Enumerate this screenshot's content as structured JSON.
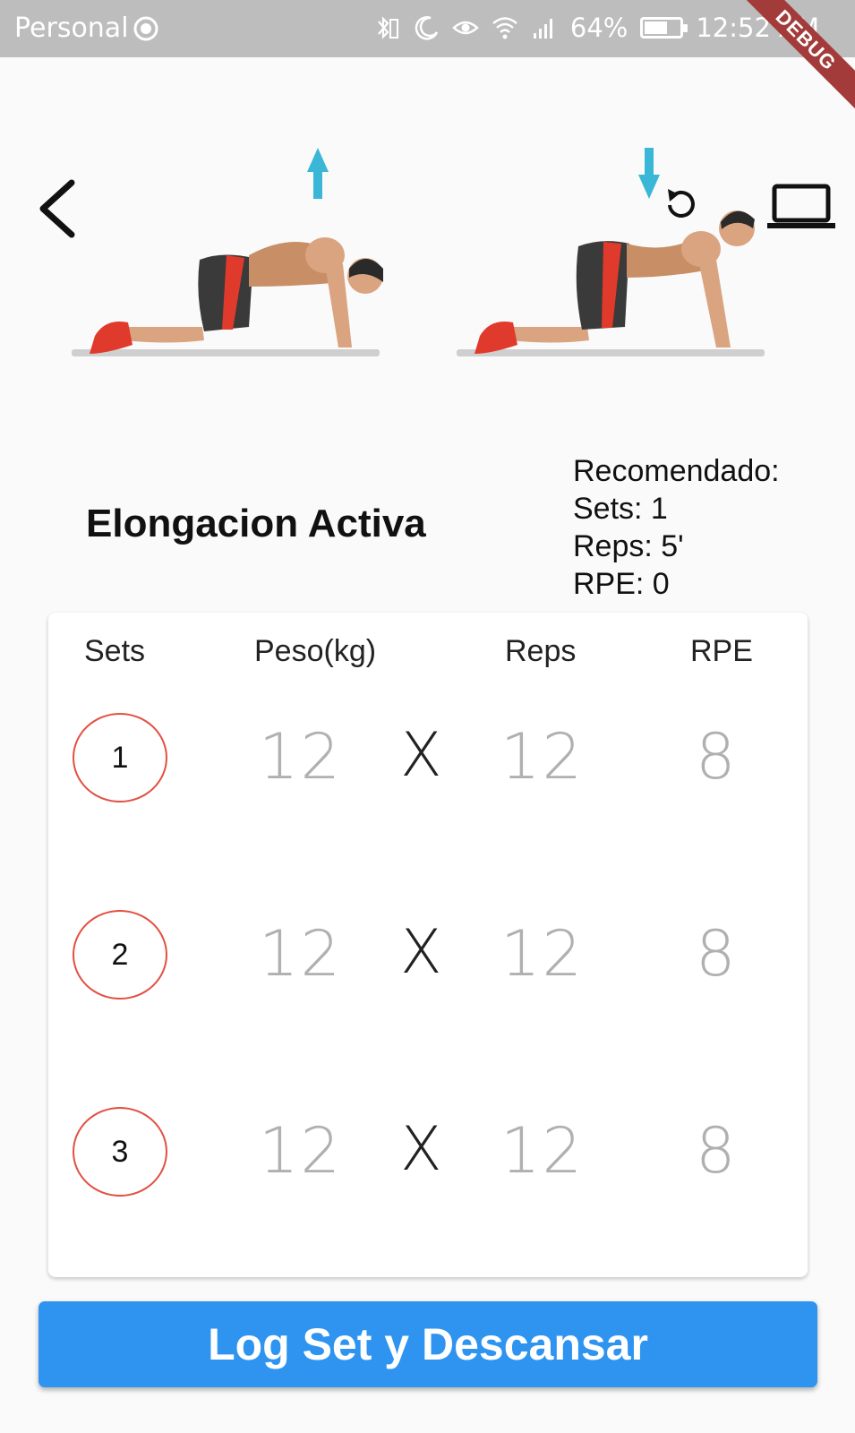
{
  "status_bar": {
    "profile": "Personal",
    "battery_percent": "64%",
    "battery_level": 0.64,
    "time": "12:52 AM"
  },
  "debug_banner": "DEBUG",
  "exercise": {
    "name": "Elongacion Activa",
    "recommended": {
      "heading": "Recomendado:",
      "sets": "Sets: 1",
      "reps": "Reps: 5'",
      "rpe": "RPE: 0"
    }
  },
  "table": {
    "headers": {
      "sets": "Sets",
      "weight": "Peso(kg)",
      "reps": "Reps",
      "rpe": "RPE"
    },
    "separator": "X",
    "rows": [
      {
        "set": "1",
        "weight": "12",
        "reps": "12",
        "rpe": "8"
      },
      {
        "set": "2",
        "weight": "12",
        "reps": "12",
        "rpe": "8"
      },
      {
        "set": "3",
        "weight": "12",
        "reps": "12",
        "rpe": "8"
      }
    ]
  },
  "actions": {
    "log_button": "Log Set y Descansar"
  },
  "colors": {
    "accent_blue": "#2e94f0",
    "set_circle_red": "#e25041",
    "arrow_cyan": "#3ab7d6",
    "shorts_red": "#e03a2c"
  },
  "icons": [
    "back-arrow-icon",
    "laptop-icon",
    "replay-icon",
    "arrow-up-icon",
    "arrow-down-icon"
  ]
}
